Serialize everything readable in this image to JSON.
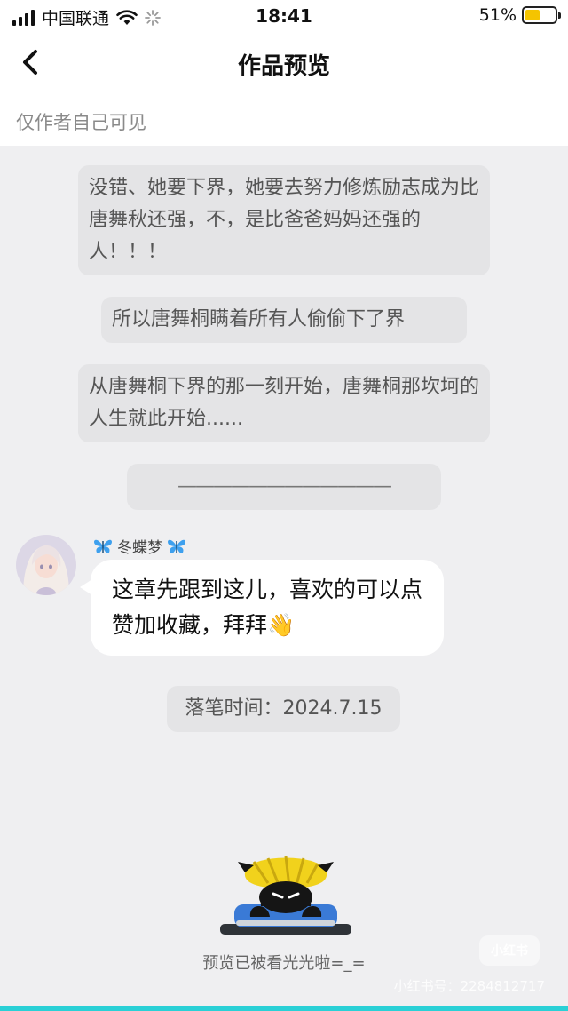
{
  "status_bar": {
    "carrier": "中国联通",
    "time": "18:41",
    "battery_percent": "51%",
    "battery_level": 0.51
  },
  "nav": {
    "title": "作品预览",
    "back_icon": "chevron-left-icon"
  },
  "visibility_note": "仅作者自己可见",
  "messages": [
    "没错、她要下界，她要去努力修炼励志成为比唐舞秋还强，不，是比爸爸妈妈还强的人！！！",
    "所以唐舞桐瞒着所有人偷偷下了界",
    "从唐舞桐下界的那一刻开始，唐舞桐那坎坷的人生就此开始......",
    "————————————"
  ],
  "chat": {
    "nickname": "冬蝶梦",
    "text": "这章先跟到这儿，喜欢的可以点赞加收藏，拜拜",
    "emoji": "👋"
  },
  "timestamp": "落笔时间：2024.7.15",
  "footer": {
    "text": "预览已被看光光啦=_="
  },
  "watermark": {
    "badge": "小红书",
    "text": "小红书号：2284812717"
  },
  "colors": {
    "background": "#efeff1",
    "system_bubble": "#e4e4e6",
    "battery": "#f5c400",
    "bottom_bar": "#2ad0d6"
  }
}
